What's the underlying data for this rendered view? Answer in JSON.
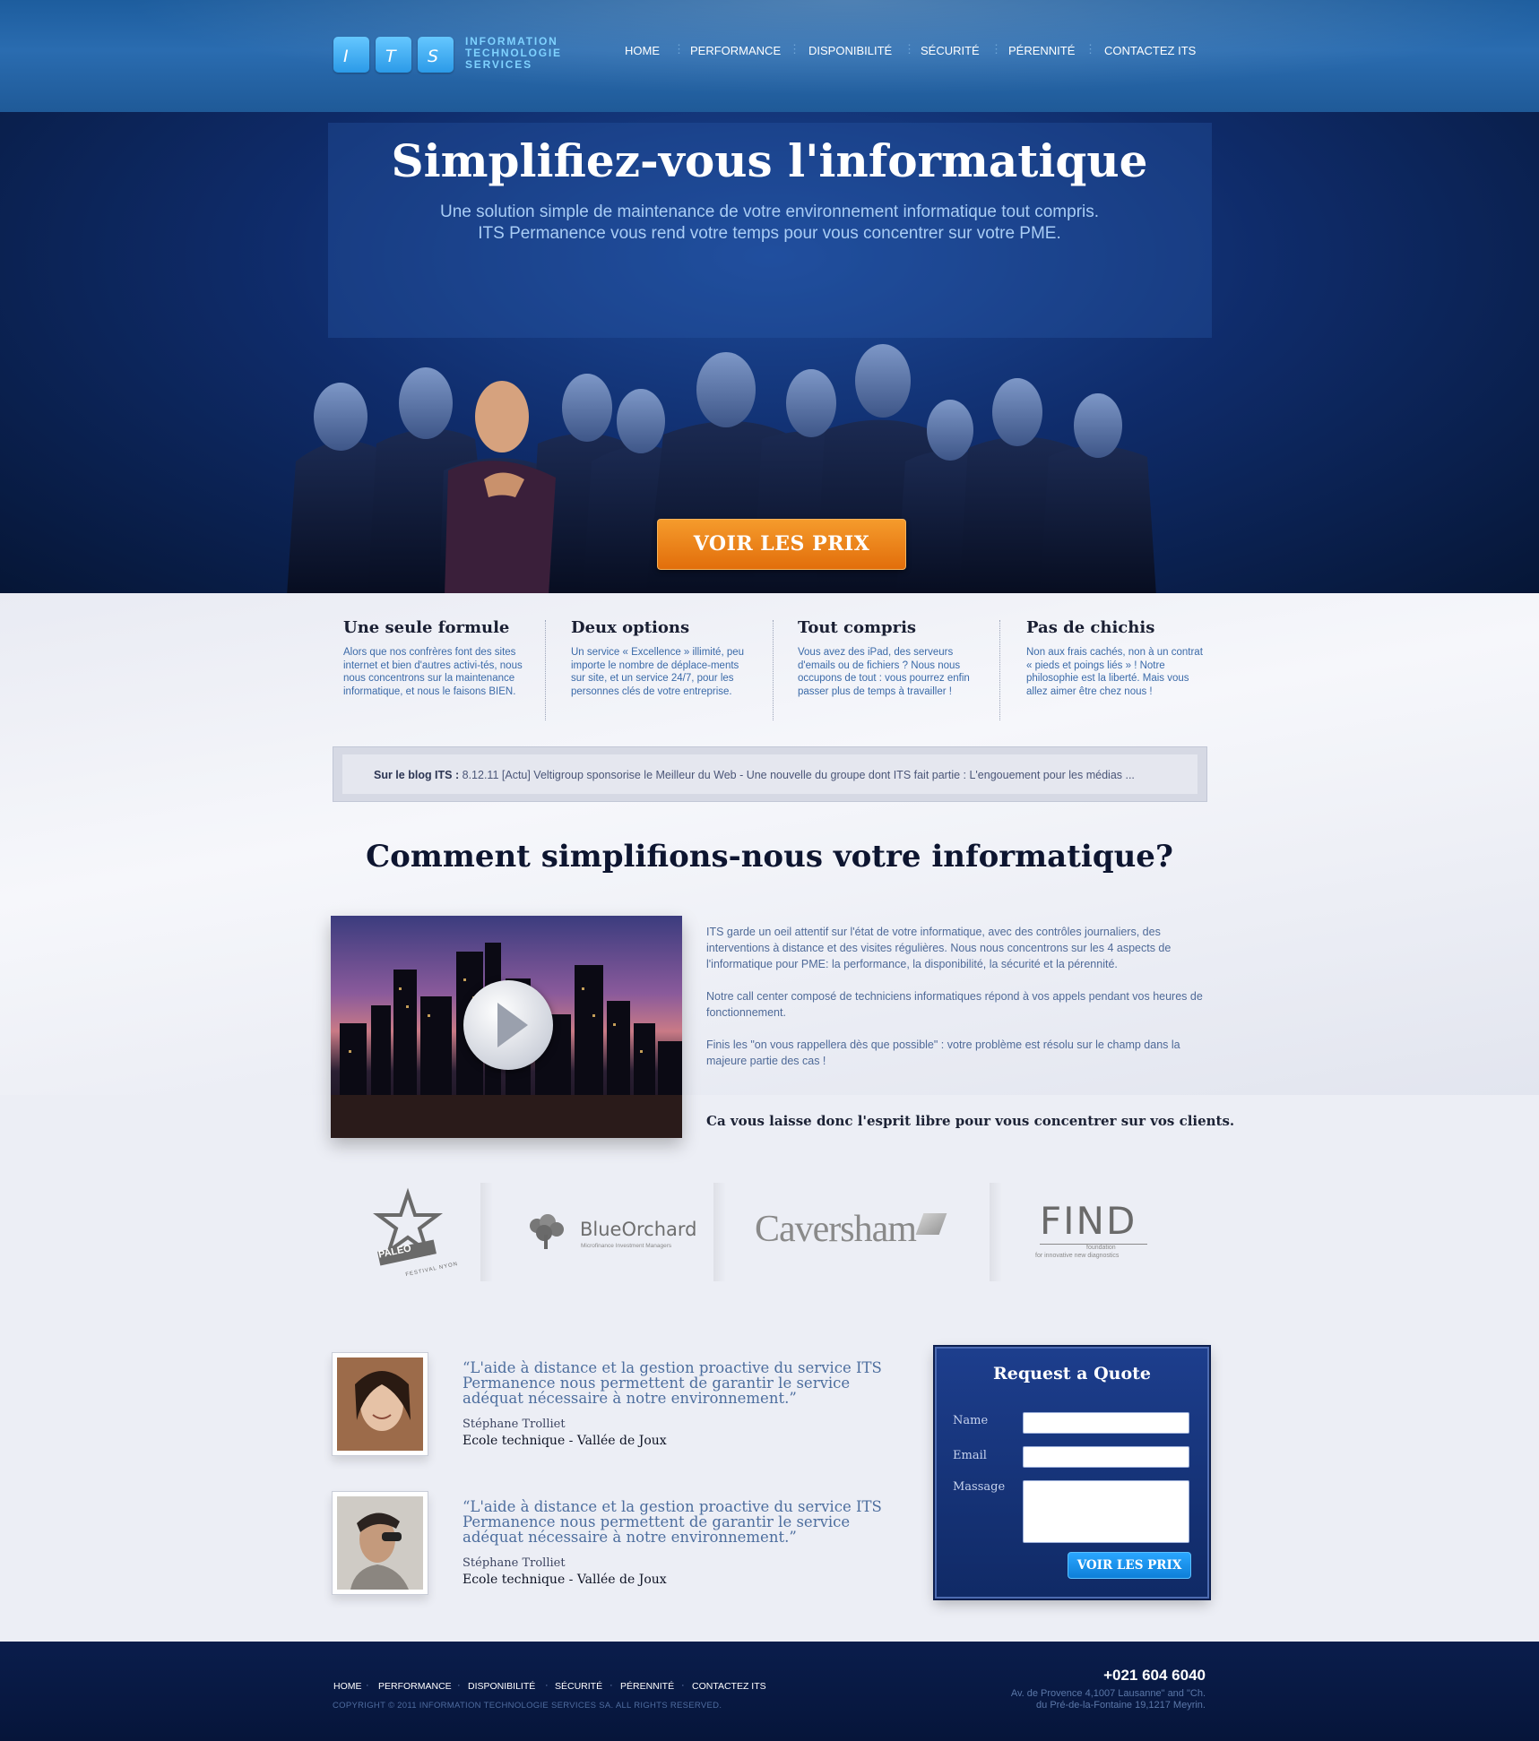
{
  "header": {
    "logo_letters": [
      "I",
      "T",
      "S"
    ],
    "logo_text_lines": [
      "INFORMATION",
      "TECHNOLOGIE",
      "SERVICES"
    ],
    "nav": [
      "HOME",
      "PERFORMANCE",
      "DISPONIBILITÉ",
      "SÉCURITÉ",
      "PÉRENNITÉ",
      "CONTACTEZ ITS"
    ]
  },
  "hero": {
    "title": "Simplifiez-vous l'informatique",
    "subtitle_line1": "Une solution simple de maintenance de votre environnement informatique tout compris.",
    "subtitle_line2": "ITS Permanence vous rend votre temps pour vous concentrer sur votre PME.",
    "cta": "VOIR LES PRIX"
  },
  "features": [
    {
      "title": "Une seule formule",
      "text": "Alors que nos confrères font des sites internet et bien d'autres activi-tés, nous nous concentrons sur la maintenance informatique, et nous le faisons BIEN."
    },
    {
      "title": "Deux options",
      "text": "Un service « Excellence » illimité, peu importe le nombre de déplace-ments sur site, et un service 24/7, pour les personnes clés de votre entreprise."
    },
    {
      "title": "Tout compris",
      "text": "Vous avez des iPad, des serveurs d'emails ou de fichiers ? Nous nous occupons de tout : vous pourrez enfin passer plus de temps à travailler !"
    },
    {
      "title": "Pas de chichis",
      "text": "Non aux frais cachés, non à un contrat « pieds et poings liés » ! Notre philosophie est la liberté. Mais vous allez aimer être chez nous !"
    }
  ],
  "blog": {
    "label": "Sur le blog ITS :",
    "text": " 8.12.11 [Actu] Veltigroup sponsorise le Meilleur du Web - Une nouvelle du groupe dont ITS fait partie : L'engouement pour les médias ..."
  },
  "how": {
    "title": "Comment simplifions-nous votre informatique?",
    "p1": "ITS garde un oeil attentif sur l'état de votre informatique, avec des contrôles journaliers, des interventions à distance et des visites régulières. Nous nous concentrons sur les 4 aspects de l'informatique pour PME: la performance, la disponibilité, la sécurité et la pérennité.",
    "p2": "Notre call center composé de techniciens informatiques répond à vos appels pendant vos heures de fonctionnement.",
    "p3": "Finis les \"on vous rappellera dès que possible\" : votre problème est résolu sur le champ dans la majeure partie des cas !",
    "bold": "Ca vous laisse donc l'esprit libre pour vous concentrer sur vos clients."
  },
  "logos": {
    "paleo": "PALEO",
    "paleo_sub": "FESTIVAL NYON",
    "blueorchard": "BlueOrchard",
    "blueorchard_sub": "Microfinance Investment Managers",
    "caversham": "Caversham",
    "find": "FIND",
    "find_sub1": "foundation",
    "find_sub2": "for innovative new diagnostics"
  },
  "testimonials": [
    {
      "quote": "“L'aide à distance et la gestion proactive du service ITS Permanence nous permettent de garantir le service adéquat nécessaire à notre environnement.”",
      "author": "Stéphane Trolliet",
      "company": "Ecole technique - Vallée de Joux"
    },
    {
      "quote": "“L'aide à distance et la gestion proactive du service ITS Permanence nous permettent de garantir le service adéquat nécessaire à notre environnement.”",
      "author": "Stéphane Trolliet",
      "company": "Ecole technique - Vallée de Joux"
    }
  ],
  "form": {
    "title": "Request a Quote",
    "name_label": "Name",
    "email_label": "Email",
    "message_label": "Massage",
    "button": "VOIR LES PRIX"
  },
  "footer": {
    "nav": [
      "HOME",
      "PERFORMANCE",
      "DISPONIBILITÉ",
      "SÉCURITÉ",
      "PÉRENNITÉ",
      "CONTACTEZ ITS"
    ],
    "copyright": "COPYRIGHT © 2011 INFORMATION TECHNOLOGIE SERVICES SA. ALL RIGHTS RESERVED.",
    "phone": "+021 604 6040",
    "address_line1": "Av. de Provence 4,1007 Lausanne\" and \"Ch.",
    "address_line2": "du Pré-de-la-Fontaine 19,1217 Meyrin."
  },
  "colors": {
    "accent_orange": "#e8780f",
    "brand_blue": "#1d4a99",
    "form_blue": "#1d3e8d"
  }
}
